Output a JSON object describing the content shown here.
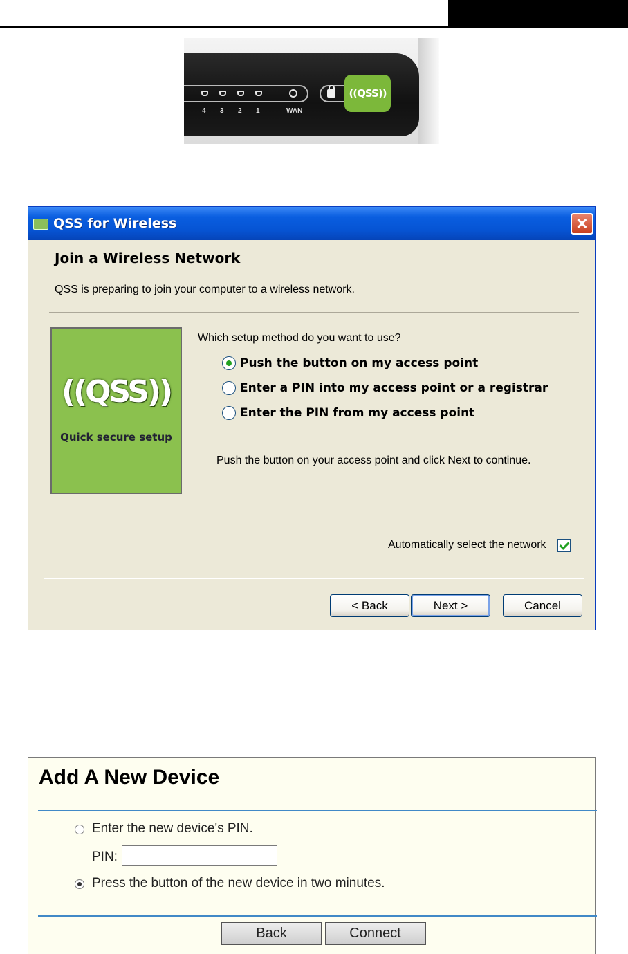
{
  "router": {
    "ports": [
      "4",
      "3",
      "2",
      "1"
    ],
    "wan_label": "WAN",
    "qss_button": "((QSS))"
  },
  "dialog": {
    "title": "QSS for Wireless",
    "close_glyph": "✕",
    "heading": "Join a Wireless Network",
    "subtitle": "QSS is preparing to join your computer to a wireless network.",
    "logo_text": "((QSS))",
    "logo_caption": "Quick secure setup",
    "question": "Which setup method do you want to use?",
    "options": [
      {
        "label": "Push the button on my access point",
        "checked": true
      },
      {
        "label": "Enter a PIN into my access point or a registrar",
        "checked": false
      },
      {
        "label": "Enter the PIN from my access point",
        "checked": false
      }
    ],
    "hint": "Push the button on your access point and click Next to continue.",
    "auto_select_label": "Automatically select the network",
    "auto_select_checked": true,
    "buttons": {
      "back": "< Back",
      "next": "Next >",
      "cancel": "Cancel"
    }
  },
  "add_device": {
    "title": "Add A New Device",
    "option_pin": "Enter the new device's PIN.",
    "pin_label": "PIN:",
    "pin_value": "",
    "option_press": "Press the button of the new device in two minutes.",
    "selected_option": "press",
    "buttons": {
      "back": "Back",
      "connect": "Connect"
    }
  },
  "colors": {
    "xp_title_blue": "#0654d4",
    "qss_green": "#8bc14e",
    "accent_line": "#4189c7",
    "panel_bg": "#fefef0"
  }
}
